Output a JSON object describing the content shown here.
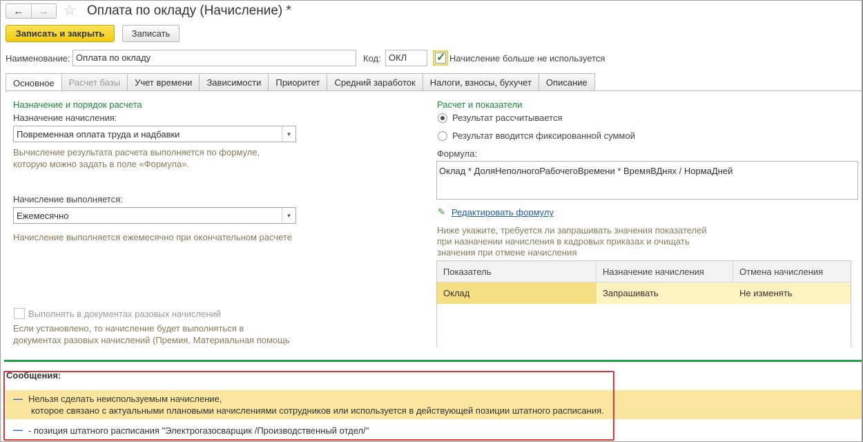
{
  "window": {
    "title": "Оплата по окладу (Начисление) *",
    "back_icon": "←",
    "forward_icon": "→",
    "favorite_icon": "☆"
  },
  "toolbar": {
    "save_close_label": "Записать и закрыть",
    "save_label": "Записать"
  },
  "header": {
    "name_label": "Наименование:",
    "name_value": "Оплата по окладу",
    "code_label": "Код:",
    "code_value": "ОКЛ",
    "not_used_label": "Начисление больше не используется",
    "not_used_checked": true
  },
  "tabs": [
    {
      "label": "Основное",
      "state": "active"
    },
    {
      "label": "Расчет базы",
      "state": "disabled"
    },
    {
      "label": "Учет времени",
      "state": "normal"
    },
    {
      "label": "Зависимости",
      "state": "normal"
    },
    {
      "label": "Приоритет",
      "state": "normal"
    },
    {
      "label": "Средний заработок",
      "state": "normal"
    },
    {
      "label": "Налоги, взносы, бухучет",
      "state": "normal"
    },
    {
      "label": "Описание",
      "state": "normal"
    }
  ],
  "left": {
    "section_title": "Назначение и порядок расчета",
    "purpose_label": "Назначение начисления:",
    "purpose_value": "Повременная оплата труда и надбавки",
    "purpose_hint_1": "Вычисление результата расчета выполняется по формуле,",
    "purpose_hint_2": "которую можно задать в поле «Формула».",
    "period_label": "Начисление выполняется:",
    "period_value": "Ежемесячно",
    "period_hint": "Начисление выполняется ежемесячно при окончательном расчете",
    "onetime_label": "Выполнять в документах разовых начислений",
    "onetime_hint_1": "Если установлено, то начисление будет выполняться в",
    "onetime_hint_2": "документах разовых начислений (Премия, Материальная помощь"
  },
  "right": {
    "section_title": "Расчет и показатели",
    "radio_calc": "Результат рассчитывается",
    "radio_fixed": "Результат вводится фиксированной суммой",
    "formula_label": "Формула:",
    "formula_value": "Оклад * ДоляНеполногоРабочегоВремени * ВремяВДнях / НормаДней",
    "edit_formula_link": "Редактировать формулу",
    "indicators_hint_1": "Ниже укажите, требуется ли запрашивать значения показателей",
    "indicators_hint_2": "при назначении начисления в кадровых приказах и очищать",
    "indicators_hint_3": "значения при отмене начисления",
    "table": {
      "columns": [
        "Показатель",
        "Назначение начисления",
        "Отмена начисления"
      ],
      "rows": [
        [
          "Оклад",
          "Запрашивать",
          "Не изменять"
        ]
      ]
    }
  },
  "messages": {
    "title": "Сообщения:",
    "item1_line1": "Нельзя сделать неиспользуемым начисление,",
    "item1_line2": "которое связано с актуальными плановыми начислениями сотрудников или используется в действующей позиции штатного расписания.",
    "item2": "- позиция штатного расписания \"Электрогазосварщик /Производственный отдел/\""
  },
  "colors": {
    "primary_button": "#f4d21f",
    "section_title": "#1c8a3a",
    "hint_text": "#8b7a5a",
    "link": "#1f5fa8",
    "message_highlight": "#fbe6a0",
    "separator": "#22a046",
    "annotation_box": "#e0343a"
  }
}
